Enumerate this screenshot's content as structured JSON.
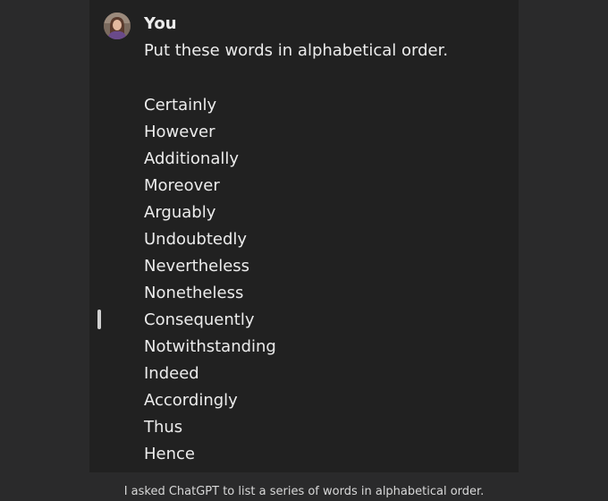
{
  "message": {
    "author": "You",
    "avatar_icon": "user-avatar-photo",
    "prompt": "Put these words in alphabetical order.",
    "words": [
      "Certainly",
      "However",
      "Additionally",
      "Moreover",
      "Arguably",
      "Undoubtedly",
      "Nevertheless",
      "Nonetheless",
      "Consequently",
      "Notwithstanding",
      "Indeed",
      "Accordingly",
      "Thus",
      "Hence"
    ]
  },
  "caption": "I asked ChatGPT to list a series of words in alphabetical order.",
  "colors": {
    "page_background": "#2a2a2b",
    "panel_background": "#212121",
    "text": "#ececec"
  }
}
